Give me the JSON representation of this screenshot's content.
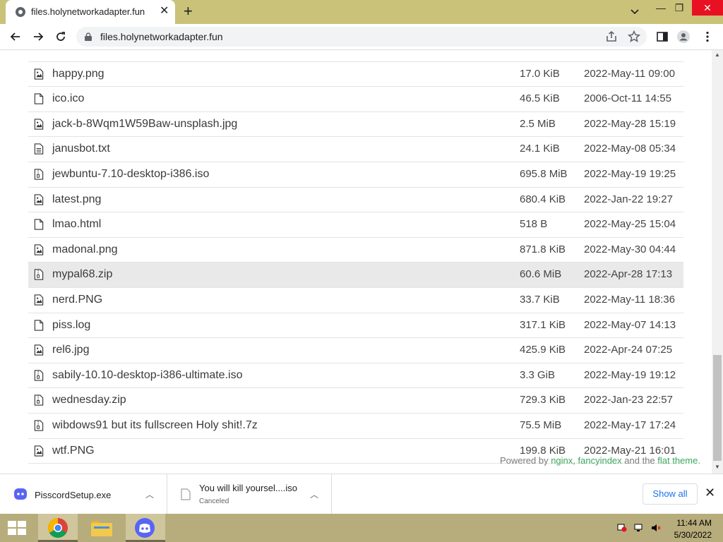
{
  "browser": {
    "tab_title": "files.holynetworkadapter.fun",
    "url": "files.holynetworkadapter.fun"
  },
  "files": [
    {
      "name": "happy.png",
      "size": "17.0 KiB",
      "date": "2022-May-11 09:00",
      "icon": "image-file-icon"
    },
    {
      "name": "ico.ico",
      "size": "46.5 KiB",
      "date": "2006-Oct-11 14:55",
      "icon": "file-icon"
    },
    {
      "name": "jack-b-8Wqm1W59Baw-unsplash.jpg",
      "size": "2.5 MiB",
      "date": "2022-May-28 15:19",
      "icon": "image-file-icon"
    },
    {
      "name": "janusbot.txt",
      "size": "24.1 KiB",
      "date": "2022-May-08 05:34",
      "icon": "text-file-icon"
    },
    {
      "name": "jewbuntu-7.10-desktop-i386.iso",
      "size": "695.8 MiB",
      "date": "2022-May-19 19:25",
      "icon": "archive-file-icon"
    },
    {
      "name": "latest.png",
      "size": "680.4 KiB",
      "date": "2022-Jan-22 19:27",
      "icon": "image-file-icon"
    },
    {
      "name": "lmao.html",
      "size": "518 B",
      "date": "2022-May-25 15:04",
      "icon": "file-icon"
    },
    {
      "name": "madonal.png",
      "size": "871.8 KiB",
      "date": "2022-May-30 04:44",
      "icon": "image-file-icon"
    },
    {
      "name": "mypal68.zip",
      "size": "60.6 MiB",
      "date": "2022-Apr-28 17:13",
      "icon": "archive-file-icon"
    },
    {
      "name": "nerd.PNG",
      "size": "33.7 KiB",
      "date": "2022-May-11 18:36",
      "icon": "image-file-icon"
    },
    {
      "name": "piss.log",
      "size": "317.1 KiB",
      "date": "2022-May-07 14:13",
      "icon": "file-icon"
    },
    {
      "name": "rel6.jpg",
      "size": "425.9 KiB",
      "date": "2022-Apr-24 07:25",
      "icon": "image-file-icon"
    },
    {
      "name": "sabily-10.10-desktop-i386-ultimate.iso",
      "size": "3.3 GiB",
      "date": "2022-May-19 19:12",
      "icon": "archive-file-icon"
    },
    {
      "name": "wednesday.zip",
      "size": "729.3 KiB",
      "date": "2022-Jan-23 22:57",
      "icon": "archive-file-icon"
    },
    {
      "name": "wibdows91 but its fullscreen Holy shit!.7z",
      "size": "75.5 MiB",
      "date": "2022-May-17 17:24",
      "icon": "archive-file-icon"
    },
    {
      "name": "wtf.PNG",
      "size": "199.8 KiB",
      "date": "2022-May-21 16:01",
      "icon": "image-file-icon"
    }
  ],
  "footer": {
    "prefix": "Powered by ",
    "nginx": "nginx",
    "sep": ", ",
    "fancyindex": "fancyindex",
    "mid": " and the ",
    "theme": "flat theme",
    "suffix": "."
  },
  "downloads": [
    {
      "name": "PisscordSetup.exe",
      "status": ""
    },
    {
      "name": "You will kill yoursel....iso",
      "status": "Canceled"
    }
  ],
  "shelf": {
    "show_all": "Show all"
  },
  "taskbar": {
    "time": "11:44 AM",
    "date": "5/30/2022"
  }
}
